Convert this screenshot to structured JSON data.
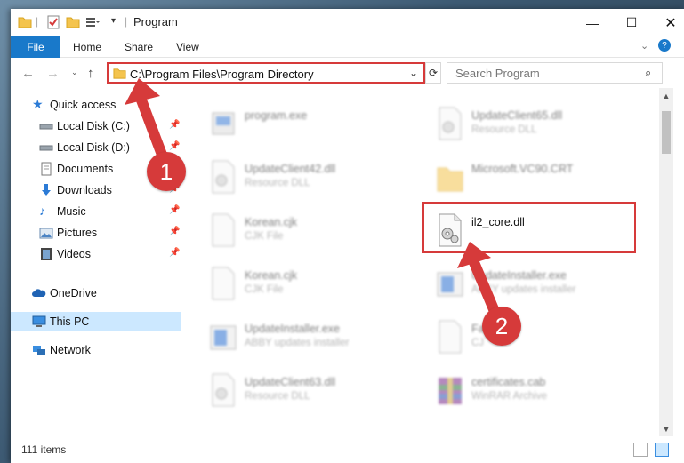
{
  "window": {
    "title": "Program"
  },
  "ribbon": {
    "tabs": [
      "File",
      "Home",
      "Share",
      "View"
    ]
  },
  "address": {
    "path": "C:\\Program Files\\Program Directory",
    "search_placeholder": "Search Program"
  },
  "sidebar": {
    "items": [
      {
        "label": "Quick access",
        "icon": "star-icon",
        "pinned": false
      },
      {
        "label": "Local Disk (C:)",
        "icon": "drive-icon",
        "pinned": true
      },
      {
        "label": "Local Disk (D:)",
        "icon": "drive-icon",
        "pinned": true
      },
      {
        "label": "Documents",
        "icon": "documents-icon",
        "pinned": true
      },
      {
        "label": "Downloads",
        "icon": "download-icon",
        "pinned": true
      },
      {
        "label": "Music",
        "icon": "music-icon",
        "pinned": true
      },
      {
        "label": "Pictures",
        "icon": "pictures-icon",
        "pinned": true
      },
      {
        "label": "Videos",
        "icon": "videos-icon",
        "pinned": true
      },
      {
        "label": "OneDrive",
        "icon": "cloud-icon",
        "pinned": false
      },
      {
        "label": "This PC",
        "icon": "pc-icon",
        "pinned": false,
        "selected": true
      },
      {
        "label": "Network",
        "icon": "network-icon",
        "pinned": false
      }
    ]
  },
  "files": {
    "left": [
      {
        "name": "program.exe",
        "type": ""
      },
      {
        "name": "UpdateClient42.dll",
        "type": "Resource DLL"
      },
      {
        "name": "Korean.cjk",
        "type": "CJK File"
      },
      {
        "name": "Korean.cjk",
        "type": "CJK File"
      },
      {
        "name": "UpdateInstaller.exe",
        "type": "ABBY updates installer"
      },
      {
        "name": "UpdateClient63.dll",
        "type": "Resource DLL"
      }
    ],
    "right": [
      {
        "name": "UpdateClient65.dll",
        "type": "Resource DLL"
      },
      {
        "name": "Microsoft.VC90.CRT",
        "type": ""
      },
      {
        "name": "il2_core.dll",
        "type": ""
      },
      {
        "name": "UpdateInstaller.exe",
        "type": "ABBY updates installer"
      },
      {
        "name": "Fa...ejk",
        "type": "CJ"
      },
      {
        "name": "certificates.cab",
        "type": "WinRAR Archive"
      }
    ]
  },
  "status": {
    "items_count": "111 items"
  },
  "badges": {
    "step1": "1",
    "step2": "2"
  },
  "colors": {
    "accent": "#1979ca",
    "highlight": "#d63a3a",
    "selected_bg": "#cce8ff"
  }
}
